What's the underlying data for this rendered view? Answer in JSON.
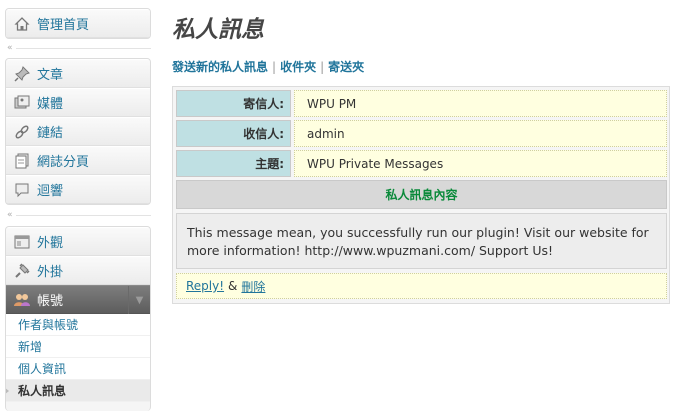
{
  "sidebar": {
    "dashboard": "管理首頁",
    "items_group1": [
      {
        "label": "文章",
        "icon": "pin-icon"
      },
      {
        "label": "媒體",
        "icon": "media-icon"
      },
      {
        "label": "鏈結",
        "icon": "link-icon"
      },
      {
        "label": "網誌分頁",
        "icon": "page-icon"
      },
      {
        "label": "迴響",
        "icon": "comment-icon"
      }
    ],
    "items_group2": [
      {
        "label": "外觀",
        "icon": "appearance-icon"
      },
      {
        "label": "外掛",
        "icon": "plugin-icon"
      }
    ],
    "active_menu": "帳號",
    "submenu": [
      "作者與帳號",
      "新增",
      "個人資訊",
      "私人訊息"
    ],
    "separator_mark": "«"
  },
  "main": {
    "title": "私人訊息",
    "subnav": {
      "send_new": "發送新的私人訊息",
      "inbox": "收件夾",
      "sent": "寄送夾",
      "pipe": "|"
    },
    "message": {
      "from_label": "寄信人:",
      "from_value": "WPU PM",
      "to_label": "收信人:",
      "to_value": "admin",
      "subject_label": "主題:",
      "subject_value": "WPU Private Messages",
      "content_header": "私人訊息內容",
      "body": "This message mean, you successfully run our plugin! Visit our website for more information! http://www.wpuzmani.com/ Support Us!",
      "reply": "Reply!",
      "amp": "&",
      "delete": "刪除"
    }
  },
  "colors": {
    "link": "#21759b",
    "label_bg": "#bfe0e3",
    "value_bg": "#ffffe0",
    "content_header_text": "#0a8a3a"
  }
}
